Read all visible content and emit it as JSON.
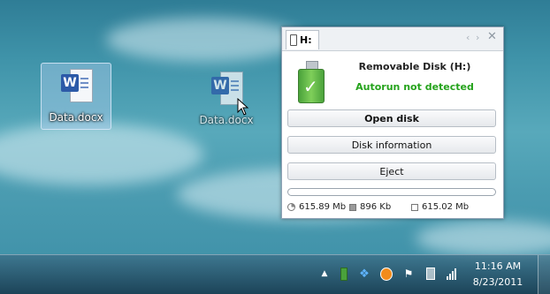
{
  "desktop": {
    "icons": [
      {
        "label": "Data.docx"
      },
      {
        "label": "Data.docx"
      }
    ]
  },
  "panel": {
    "tab_label": "H:",
    "title": "Removable Disk  (H:)",
    "status": "Autorun not detected",
    "status_color": "#25a31c",
    "buttons": {
      "open": "Open disk",
      "info": "Disk information",
      "eject": "Eject"
    },
    "usage_fraction": 0.0,
    "stats": {
      "total": "615.89 Mb",
      "used": "896 Kb",
      "free": "615.02 Mb"
    }
  },
  "taskbar": {
    "tray_icons": [
      "chevron-up-icon",
      "usb-drive-icon",
      "dropbox-icon",
      "avast-icon",
      "flag-icon",
      "battery-icon",
      "signal-bars-icon"
    ],
    "clock": {
      "time": "11:16 AM",
      "date": "8/23/2011"
    }
  }
}
